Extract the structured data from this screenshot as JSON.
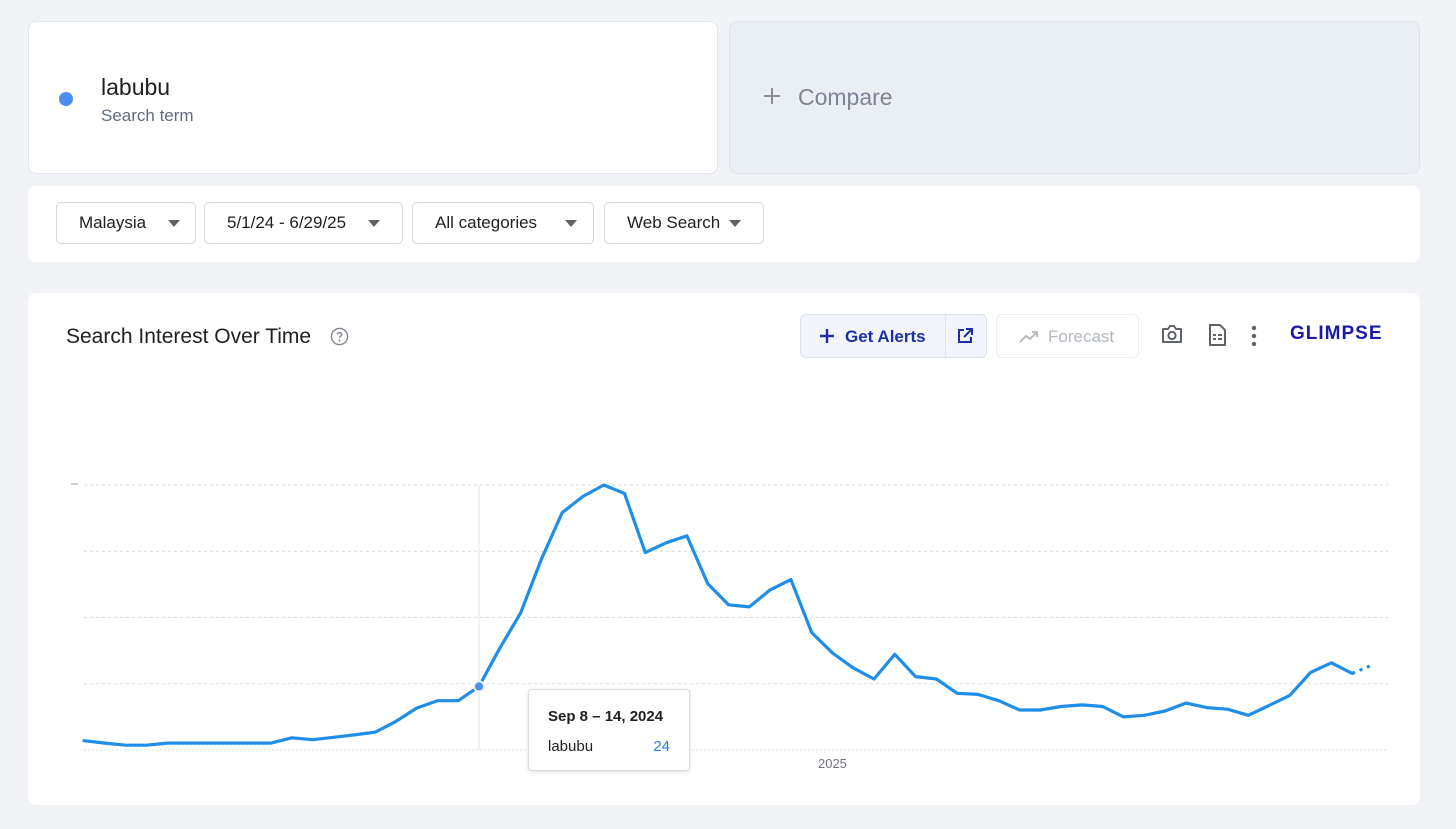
{
  "term": {
    "name": "labubu",
    "type": "Search term",
    "color": "#4e8ef2"
  },
  "compare": {
    "label": "Compare"
  },
  "filters": {
    "region": "Malaysia",
    "date_range": "5/1/24 - 6/29/25",
    "category": "All categories",
    "search_type": "Web Search"
  },
  "chart_header": {
    "title": "Search Interest Over Time",
    "get_alerts_label": "Get Alerts",
    "forecast_label": "Forecast",
    "brand": "GLIMPSE"
  },
  "icons": [
    "help-icon",
    "plus-icon",
    "external-link-icon",
    "trending-up-icon",
    "camera-icon",
    "sheet-icon",
    "more-vert-icon"
  ],
  "tooltip": {
    "date": "Sep 8 – 14, 2024",
    "term": "labubu",
    "value": "24"
  },
  "chart_data": {
    "type": "line",
    "title": "Search Interest Over Time",
    "xlabel": "",
    "ylabel": "",
    "x_tick_labels": [
      "2025"
    ],
    "x_tick_index": 36,
    "ylim": [
      0,
      100
    ],
    "grid": true,
    "legend": "none",
    "highlight_index": 19,
    "series": [
      {
        "name": "labubu",
        "color": "#1e8ee8",
        "values": [
          3.5,
          2.6,
          1.8,
          1.8,
          2.6,
          2.6,
          2.6,
          2.6,
          2.6,
          2.6,
          4.6,
          3.9,
          4.8,
          5.7,
          6.7,
          10.8,
          15.8,
          18.6,
          18.6,
          24,
          38.4,
          51.7,
          72,
          89.6,
          95.7,
          100,
          96.8,
          74.5,
          78.2,
          80.8,
          62.8,
          54.8,
          54,
          60.4,
          64.3,
          44.3,
          36.6,
          31,
          26.8,
          36.1,
          27.7,
          26.8,
          21.4,
          21,
          18.6,
          15.1,
          15.1,
          16.4,
          17,
          16.4,
          12.5,
          13.1,
          14.7,
          17.7,
          16,
          15.4,
          13.1,
          16.8,
          20.6,
          29.3,
          32.9,
          28.9,
          32.2
        ]
      }
    ],
    "forecast_segment_from_index": 61
  }
}
